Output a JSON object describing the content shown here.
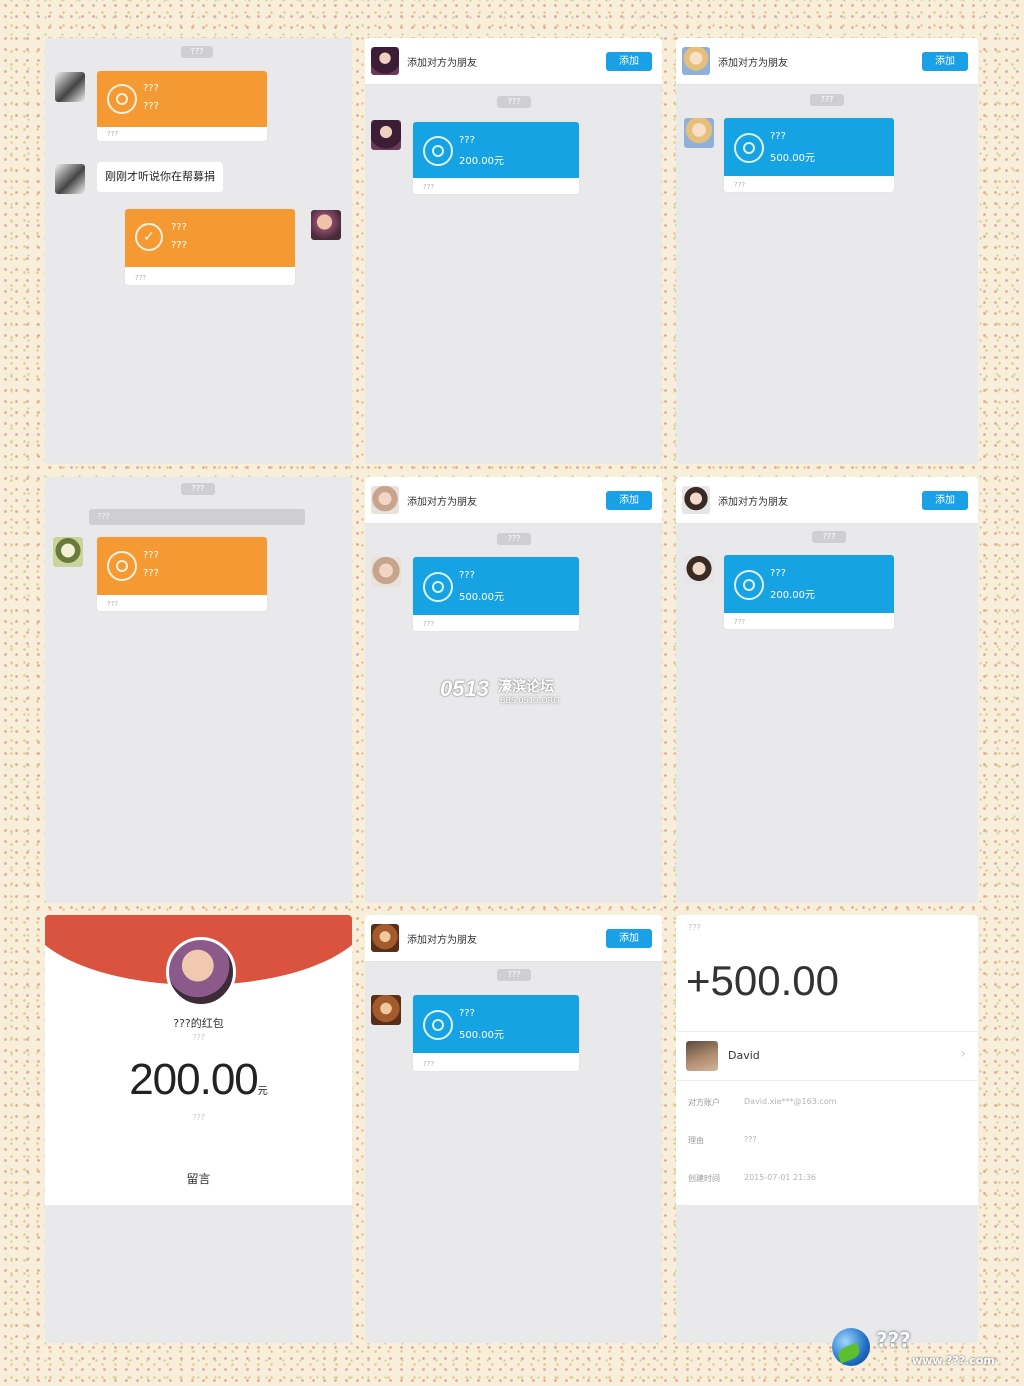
{
  "panel1": {
    "time": "???",
    "card1": {
      "title": "???",
      "subtitle": "???",
      "footer": "???"
    },
    "message": "刚刚才听说你在帮募捐",
    "card2": {
      "title": "???",
      "subtitle": "???",
      "footer": "???"
    }
  },
  "panel2": {
    "header_text": "添加对方为朋友",
    "add_button": "添加",
    "time": "???",
    "card": {
      "title": "???",
      "amount": "200.00元",
      "footer": "???"
    }
  },
  "panel3": {
    "header_text": "添加对方为朋友",
    "add_button": "添加",
    "time": "???",
    "card": {
      "title": "???",
      "amount": "500.00元",
      "footer": "???"
    }
  },
  "panel4": {
    "time": "???",
    "notice": "???",
    "card": {
      "title": "???",
      "subtitle": "???",
      "footer": "???"
    }
  },
  "panel5": {
    "header_text": "添加对方为朋友",
    "add_button": "添加",
    "time": "???",
    "card": {
      "title": "???",
      "amount": "500.00元",
      "footer": "???"
    }
  },
  "panel6": {
    "header_text": "添加对方为朋友",
    "add_button": "添加",
    "time": "???",
    "card": {
      "title": "???",
      "amount": "200.00元",
      "footer": "???"
    }
  },
  "panel7": {
    "name": "???的红包",
    "subtitle": "???",
    "amount": "200.00",
    "unit": "元",
    "note": "???",
    "message": "留言"
  },
  "panel8": {
    "header_text": "添加对方为朋友",
    "add_button": "添加",
    "time": "???",
    "card": {
      "title": "???",
      "amount": "500.00元",
      "footer": "???"
    }
  },
  "panel9": {
    "status": "???",
    "amount": "+500.00",
    "user_name": "David",
    "rows": [
      {
        "label": "对方账户",
        "value": "David.xie***@163.com"
      },
      {
        "label": "理由",
        "value": "???"
      },
      {
        "label": "创建时间",
        "value": "2015-07-01 21:36"
      }
    ]
  },
  "watermark": {
    "logo": "0513",
    "name": "濠滨论坛",
    "url": "BBS.0513.ORG"
  },
  "corner_watermark": {
    "name": "???",
    "url": "www.???.com"
  },
  "colors": {
    "orange": "#f59a32",
    "blue": "#16a3e3",
    "red_packet": "#d9533f",
    "add_button": "#1aa0e6"
  }
}
